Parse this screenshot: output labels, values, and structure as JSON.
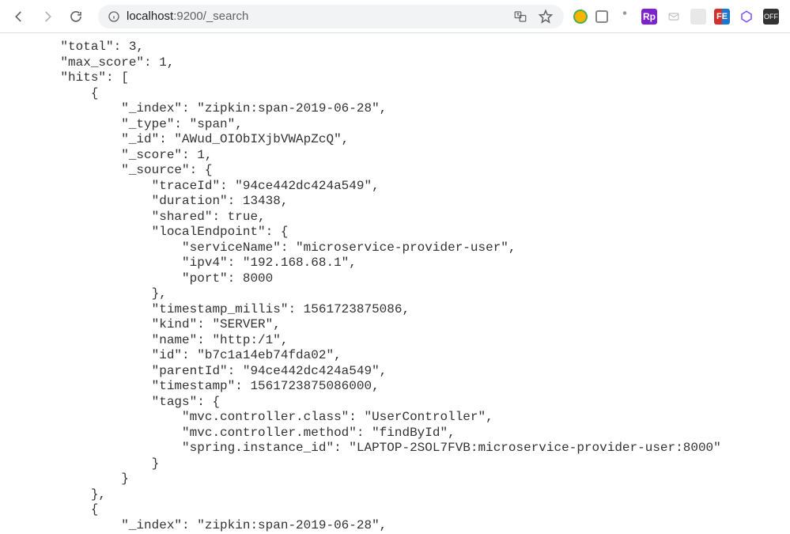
{
  "browser": {
    "url_host": "localhost",
    "url_port": ":9200",
    "url_path": "/_search"
  },
  "json_lines": [
    "    \"total\": 3,",
    "    \"max_score\": 1,",
    "    \"hits\": [",
    "        {",
    "            \"_index\": \"zipkin:span-2019-06-28\",",
    "            \"_type\": \"span\",",
    "            \"_id\": \"AWud_OIObIXjbVWApZcQ\",",
    "            \"_score\": 1,",
    "            \"_source\": {",
    "                \"traceId\": \"94ce442dc424a549\",",
    "                \"duration\": 13438,",
    "                \"shared\": true,",
    "                \"localEndpoint\": {",
    "                    \"serviceName\": \"microservice-provider-user\",",
    "                    \"ipv4\": \"192.168.68.1\",",
    "                    \"port\": 8000",
    "                },",
    "                \"timestamp_millis\": 1561723875086,",
    "                \"kind\": \"SERVER\",",
    "                \"name\": \"http:/1\",",
    "                \"id\": \"b7c1a14eb74fda02\",",
    "                \"parentId\": \"94ce442dc424a549\",",
    "                \"timestamp\": 1561723875086000,",
    "                \"tags\": {",
    "                    \"mvc.controller.class\": \"UserController\",",
    "                    \"mvc.controller.method\": \"findById\",",
    "                    \"spring.instance_id\": \"LAPTOP-2SOL7FVB:microservice-provider-user:8000\"",
    "                }",
    "            }",
    "        },",
    "        {",
    "            \"_index\": \"zipkin:span-2019-06-28\","
  ],
  "response_data": {
    "total": 3,
    "max_score": 1,
    "hits": [
      {
        "_index": "zipkin:span-2019-06-28",
        "_type": "span",
        "_id": "AWud_OIObIXjbVWApZcQ",
        "_score": 1,
        "_source": {
          "traceId": "94ce442dc424a549",
          "duration": 13438,
          "shared": true,
          "localEndpoint": {
            "serviceName": "microservice-provider-user",
            "ipv4": "192.168.68.1",
            "port": 8000
          },
          "timestamp_millis": 1561723875086,
          "kind": "SERVER",
          "name": "http:/1",
          "id": "b7c1a14eb74fda02",
          "parentId": "94ce442dc424a549",
          "timestamp": 1561723875086000,
          "tags": {
            "mvc.controller.class": "UserController",
            "mvc.controller.method": "findById",
            "spring.instance_id": "LAPTOP-2SOL7FVB:microservice-provider-user:8000"
          }
        }
      }
    ]
  }
}
